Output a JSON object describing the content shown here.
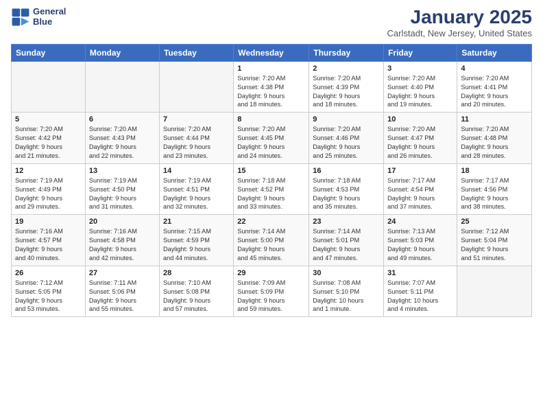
{
  "header": {
    "logo_line1": "General",
    "logo_line2": "Blue",
    "title": "January 2025",
    "subtitle": "Carlstadt, New Jersey, United States"
  },
  "weekdays": [
    "Sunday",
    "Monday",
    "Tuesday",
    "Wednesday",
    "Thursday",
    "Friday",
    "Saturday"
  ],
  "weeks": [
    [
      {
        "day": "",
        "info": ""
      },
      {
        "day": "",
        "info": ""
      },
      {
        "day": "",
        "info": ""
      },
      {
        "day": "1",
        "info": "Sunrise: 7:20 AM\nSunset: 4:38 PM\nDaylight: 9 hours\nand 18 minutes."
      },
      {
        "day": "2",
        "info": "Sunrise: 7:20 AM\nSunset: 4:39 PM\nDaylight: 9 hours\nand 18 minutes."
      },
      {
        "day": "3",
        "info": "Sunrise: 7:20 AM\nSunset: 4:40 PM\nDaylight: 9 hours\nand 19 minutes."
      },
      {
        "day": "4",
        "info": "Sunrise: 7:20 AM\nSunset: 4:41 PM\nDaylight: 9 hours\nand 20 minutes."
      }
    ],
    [
      {
        "day": "5",
        "info": "Sunrise: 7:20 AM\nSunset: 4:42 PM\nDaylight: 9 hours\nand 21 minutes."
      },
      {
        "day": "6",
        "info": "Sunrise: 7:20 AM\nSunset: 4:43 PM\nDaylight: 9 hours\nand 22 minutes."
      },
      {
        "day": "7",
        "info": "Sunrise: 7:20 AM\nSunset: 4:44 PM\nDaylight: 9 hours\nand 23 minutes."
      },
      {
        "day": "8",
        "info": "Sunrise: 7:20 AM\nSunset: 4:45 PM\nDaylight: 9 hours\nand 24 minutes."
      },
      {
        "day": "9",
        "info": "Sunrise: 7:20 AM\nSunset: 4:46 PM\nDaylight: 9 hours\nand 25 minutes."
      },
      {
        "day": "10",
        "info": "Sunrise: 7:20 AM\nSunset: 4:47 PM\nDaylight: 9 hours\nand 26 minutes."
      },
      {
        "day": "11",
        "info": "Sunrise: 7:20 AM\nSunset: 4:48 PM\nDaylight: 9 hours\nand 28 minutes."
      }
    ],
    [
      {
        "day": "12",
        "info": "Sunrise: 7:19 AM\nSunset: 4:49 PM\nDaylight: 9 hours\nand 29 minutes."
      },
      {
        "day": "13",
        "info": "Sunrise: 7:19 AM\nSunset: 4:50 PM\nDaylight: 9 hours\nand 31 minutes."
      },
      {
        "day": "14",
        "info": "Sunrise: 7:19 AM\nSunset: 4:51 PM\nDaylight: 9 hours\nand 32 minutes."
      },
      {
        "day": "15",
        "info": "Sunrise: 7:18 AM\nSunset: 4:52 PM\nDaylight: 9 hours\nand 33 minutes."
      },
      {
        "day": "16",
        "info": "Sunrise: 7:18 AM\nSunset: 4:53 PM\nDaylight: 9 hours\nand 35 minutes."
      },
      {
        "day": "17",
        "info": "Sunrise: 7:17 AM\nSunset: 4:54 PM\nDaylight: 9 hours\nand 37 minutes."
      },
      {
        "day": "18",
        "info": "Sunrise: 7:17 AM\nSunset: 4:56 PM\nDaylight: 9 hours\nand 38 minutes."
      }
    ],
    [
      {
        "day": "19",
        "info": "Sunrise: 7:16 AM\nSunset: 4:57 PM\nDaylight: 9 hours\nand 40 minutes."
      },
      {
        "day": "20",
        "info": "Sunrise: 7:16 AM\nSunset: 4:58 PM\nDaylight: 9 hours\nand 42 minutes."
      },
      {
        "day": "21",
        "info": "Sunrise: 7:15 AM\nSunset: 4:59 PM\nDaylight: 9 hours\nand 44 minutes."
      },
      {
        "day": "22",
        "info": "Sunrise: 7:14 AM\nSunset: 5:00 PM\nDaylight: 9 hours\nand 45 minutes."
      },
      {
        "day": "23",
        "info": "Sunrise: 7:14 AM\nSunset: 5:01 PM\nDaylight: 9 hours\nand 47 minutes."
      },
      {
        "day": "24",
        "info": "Sunrise: 7:13 AM\nSunset: 5:03 PM\nDaylight: 9 hours\nand 49 minutes."
      },
      {
        "day": "25",
        "info": "Sunrise: 7:12 AM\nSunset: 5:04 PM\nDaylight: 9 hours\nand 51 minutes."
      }
    ],
    [
      {
        "day": "26",
        "info": "Sunrise: 7:12 AM\nSunset: 5:05 PM\nDaylight: 9 hours\nand 53 minutes."
      },
      {
        "day": "27",
        "info": "Sunrise: 7:11 AM\nSunset: 5:06 PM\nDaylight: 9 hours\nand 55 minutes."
      },
      {
        "day": "28",
        "info": "Sunrise: 7:10 AM\nSunset: 5:08 PM\nDaylight: 9 hours\nand 57 minutes."
      },
      {
        "day": "29",
        "info": "Sunrise: 7:09 AM\nSunset: 5:09 PM\nDaylight: 9 hours\nand 59 minutes."
      },
      {
        "day": "30",
        "info": "Sunrise: 7:08 AM\nSunset: 5:10 PM\nDaylight: 10 hours\nand 1 minute."
      },
      {
        "day": "31",
        "info": "Sunrise: 7:07 AM\nSunset: 5:11 PM\nDaylight: 10 hours\nand 4 minutes."
      },
      {
        "day": "",
        "info": ""
      }
    ]
  ]
}
